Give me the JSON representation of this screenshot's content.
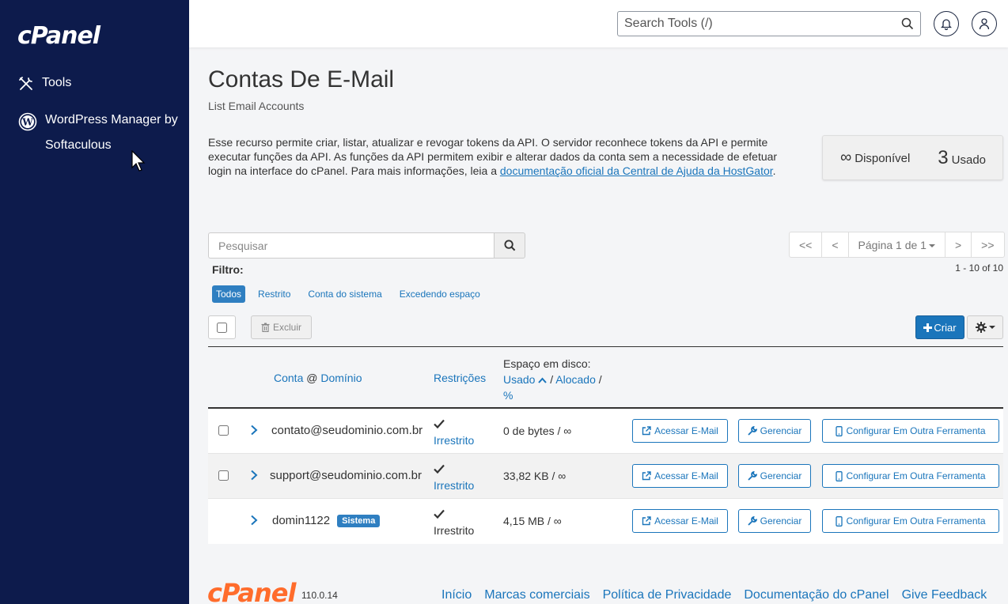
{
  "sidebar": {
    "logo": "cPanel",
    "items": [
      {
        "label": "Tools",
        "icon": "tools-icon"
      },
      {
        "label": "WordPress Manager by Softaculous",
        "icon": "wordpress-icon"
      }
    ]
  },
  "topbar": {
    "search_placeholder": "Search Tools (/)",
    "icons": [
      "search-icon",
      "bell-icon",
      "user-icon"
    ]
  },
  "header": {
    "title": "Contas De E-Mail",
    "subtitle": "List Email Accounts",
    "description": "Esse recurso permite criar, listar, atualizar e revogar tokens da API. O servidor reconhece tokens da API e permite executar funções da API. As funções da API permitem exibir e alterar dados da conta sem a necessidade de efetuar login na interface do cPanel. Para mais informações, leia a ",
    "doc_link": "documentação oficial da Central de Ajuda da HostGator",
    "description_end": "."
  },
  "stats": {
    "available_value": "∞",
    "available_label": "Disponível",
    "used_value": "3",
    "used_label": "Usado"
  },
  "list": {
    "search_placeholder": "Pesquisar",
    "pager": {
      "first": "<<",
      "prev": "<",
      "page": "Página 1 de 1",
      "next": ">",
      "last": ">>"
    },
    "count": "1 - 10 of 10",
    "filter_label": "Filtro:",
    "filters": [
      "Todos",
      "Restrito",
      "Conta do sistema",
      "Excedendo espaço"
    ],
    "delete_label": "Excluir",
    "create_label": "Criar"
  },
  "table": {
    "headers": {
      "conta": "Conta",
      "at": "@",
      "dominio": "Domínio",
      "restricoes": "Restrições",
      "espaco": "Espaço em disco:",
      "usado": "Usado",
      "alocado": "Alocado",
      "pct": "%"
    },
    "rows": [
      {
        "account": "contato@seudominio.com.br",
        "restriction": "Irrestrito",
        "disk": "0 de bytes / ∞",
        "badge": ""
      },
      {
        "account": "support@seudominio.com.br",
        "restriction": "Irrestrito",
        "disk": "33,82 KB / ∞",
        "badge": ""
      },
      {
        "account": "domin1122",
        "restriction": "Irrestrito",
        "disk": "4,15 MB / ∞",
        "badge": "Sistema"
      }
    ],
    "actions": {
      "acessar": "Acessar E-Mail",
      "gerenciar": "Gerenciar",
      "configurar": "Configurar Em Outra Ferramenta"
    }
  },
  "footer": {
    "logo": "cPanel",
    "version": "110.0.14",
    "links": [
      "Início",
      "Marcas comerciais",
      "Política de Privacidade",
      "Documentação do cPanel",
      "Give Feedback"
    ]
  },
  "colors": {
    "sidebar_bg": "#0d1b4c",
    "accent": "#1a75bb",
    "footer_logo": "#ff6c2c"
  }
}
